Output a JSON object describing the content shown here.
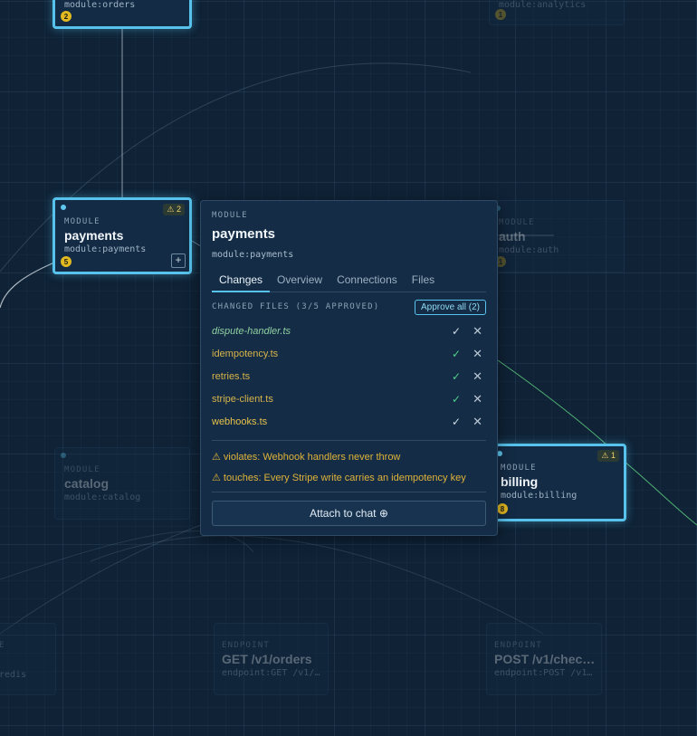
{
  "nodes": {
    "orders": {
      "kind": "",
      "title": "",
      "mid": "module:orders",
      "count": "2"
    },
    "analytics": {
      "kind": "",
      "title": "",
      "mid": "module:analytics",
      "count": "1"
    },
    "payments": {
      "kind": "MODULE",
      "title": "payments",
      "mid": "module:payments",
      "count": "5",
      "warn": "⚠ 2",
      "plus": "+"
    },
    "auth": {
      "kind": "MODULE",
      "title": "auth",
      "mid": "module:auth",
      "count": "1"
    },
    "catalog": {
      "kind": "MODULE",
      "title": "catalog",
      "mid": "module:catalog"
    },
    "billing": {
      "kind": "MODULE",
      "title": "billing",
      "mid": "module:billing",
      "count": "8",
      "warn": "⚠ 1"
    },
    "redis": {
      "kind": "E",
      "title": "",
      "mid": "redis"
    },
    "get_orders": {
      "kind": "ENDPOINT",
      "title": "GET /v1/orders",
      "mid": "endpoint:GET /v1/…"
    },
    "post_check": {
      "kind": "ENDPOINT",
      "title": "POST /v1/chec…",
      "mid": "endpoint:POST /v1…"
    }
  },
  "popup": {
    "kind": "MODULE",
    "title": "payments",
    "module_id": "module:payments",
    "tabs": [
      "Changes",
      "Overview",
      "Connections",
      "Files"
    ],
    "active_tab": "Changes",
    "changed_files_header": "CHANGED FILES (3/5 APPROVED)",
    "approve_all": "Approve all (2)",
    "files": [
      {
        "name": "dispute-handler.ts",
        "check": "✓",
        "remove": "✕"
      },
      {
        "name": "idempotency.ts",
        "check": "✓",
        "remove": "✕"
      },
      {
        "name": "retries.ts",
        "check": "✓",
        "remove": "✕"
      },
      {
        "name": "stripe-client.ts",
        "check": "✓",
        "remove": "✕"
      },
      {
        "name": "webhooks.ts",
        "check": "✓",
        "remove": "✕"
      }
    ],
    "warnings": [
      "⚠  violates: Webhook handlers never throw",
      "⚠  touches: Every Stripe write carries an idempotency key"
    ],
    "attach_button": "Attach to chat ⊕"
  },
  "colors": {
    "accent": "#57c3ec",
    "approved": "#4fd08a",
    "warning": "#e0b33a",
    "background": "#0f2236"
  }
}
